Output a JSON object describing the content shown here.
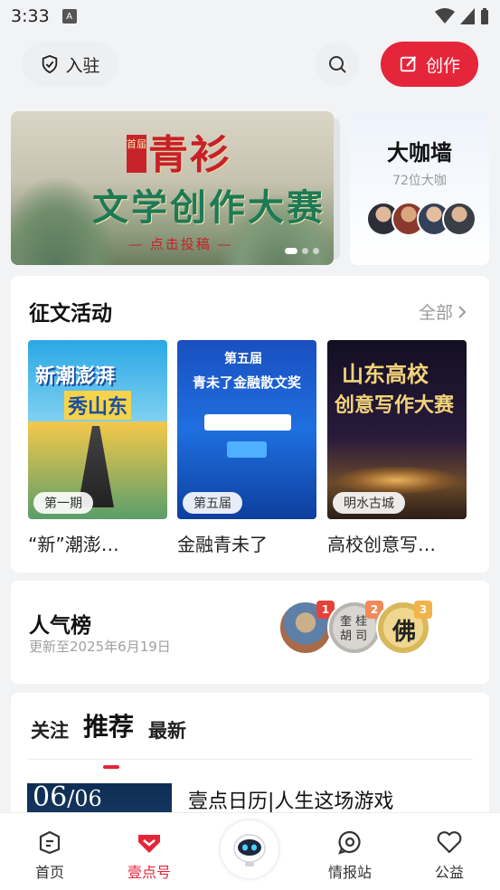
{
  "status_bar": {
    "time": "3:33",
    "notif_icon": "A"
  },
  "topbar": {
    "join_label": "入驻",
    "create_label": "创作"
  },
  "banner": {
    "tag": "首届",
    "title_line1": "青衫",
    "title_line2": "文学创作大赛",
    "subtitle": "— 点击投稿 —",
    "dots": 3,
    "active_dot": 1
  },
  "coffee_wall": {
    "title": "大咖墙",
    "count": "72位大咖"
  },
  "essay": {
    "title": "征文活动",
    "all_label": "全部",
    "items": [
      {
        "badge": "第一期",
        "label": "“新”潮澎…",
        "poster_line1": "新潮澎湃",
        "poster_line2": "秀山东"
      },
      {
        "badge": "第五届",
        "label": "金融青未了",
        "poster_line1": "第五届",
        "poster_line2": "青未了金融散文奖"
      },
      {
        "badge": "明水古城",
        "label": "高校创意写…",
        "poster_line1": "山东高校",
        "poster_line2": "创意写作大赛"
      }
    ]
  },
  "rank": {
    "title": "人气榜",
    "updated": "更新至2025年6月19日",
    "ranks": [
      "1",
      "2",
      "3"
    ]
  },
  "feed": {
    "tabs": [
      "关注",
      "推荐",
      "最新"
    ],
    "active_tab": "推荐",
    "article": {
      "thumb_date": "06",
      "thumb_date2": "06",
      "title": "壹点日历|人生这场游戏"
    }
  },
  "bottom_nav": {
    "items": [
      {
        "label": "首页",
        "icon": "home-icon"
      },
      {
        "label": "壹点号",
        "icon": "yidian-icon"
      },
      {
        "label": "情报站",
        "icon": "intel-icon"
      },
      {
        "label": "公益",
        "icon": "heart-icon"
      }
    ]
  },
  "colors": {
    "accent": "#e5253a",
    "background": "#f2f3f5"
  }
}
